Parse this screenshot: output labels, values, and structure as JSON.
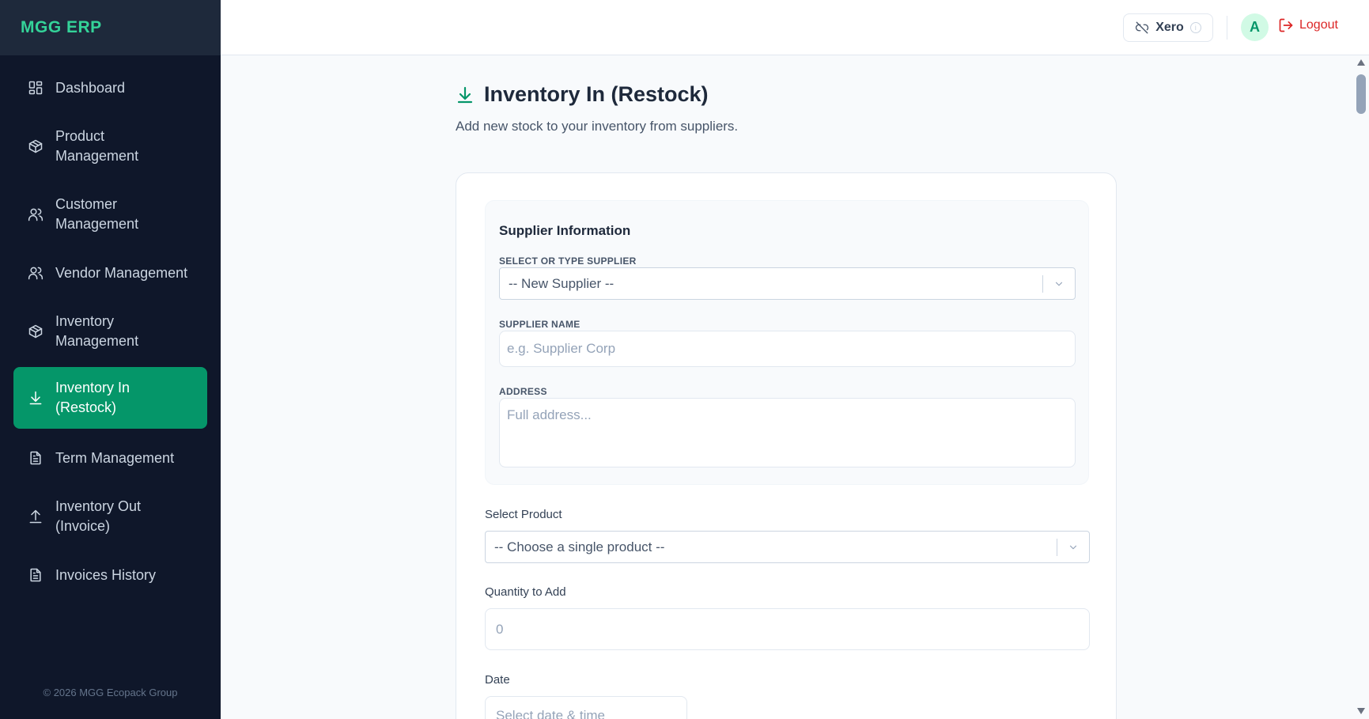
{
  "app": {
    "brand": "MGG ERP",
    "copyright": "© 2026 MGG Ecopack Group"
  },
  "sidebar": {
    "items": [
      {
        "label": "Dashboard",
        "icon": "dashboard-icon"
      },
      {
        "label": "Product Management",
        "icon": "box-icon"
      },
      {
        "label": "Customer Management",
        "icon": "users-icon"
      },
      {
        "label": "Vendor Management",
        "icon": "users-icon"
      },
      {
        "label": "Inventory Management",
        "icon": "box-icon"
      },
      {
        "label": "Inventory In (Restock)",
        "icon": "download-icon",
        "active": true
      },
      {
        "label": "Term Management",
        "icon": "document-icon"
      },
      {
        "label": "Inventory Out (Invoice)",
        "icon": "upload-icon"
      },
      {
        "label": "Invoices History",
        "icon": "document-icon"
      }
    ]
  },
  "topbar": {
    "xero_label": "Xero",
    "avatar_initial": "A",
    "logout_label": "Logout"
  },
  "page": {
    "title": "Inventory In (Restock)",
    "subtitle": "Add new stock to your inventory from suppliers."
  },
  "form": {
    "supplier_section_title": "Supplier Information",
    "select_supplier_label": "SELECT OR TYPE SUPPLIER",
    "select_supplier_value": "-- New Supplier --",
    "supplier_name_label": "SUPPLIER NAME",
    "supplier_name_placeholder": "e.g. Supplier Corp",
    "address_label": "ADDRESS",
    "address_placeholder": "Full address...",
    "product_label": "Select Product",
    "product_value": "-- Choose a single product --",
    "quantity_label": "Quantity to Add",
    "quantity_placeholder": "0",
    "date_label": "Date",
    "date_placeholder": "Select date & time"
  },
  "colors": {
    "accent": "#059669",
    "sidebar_bg": "#0f172a",
    "danger": "#dc2626"
  }
}
